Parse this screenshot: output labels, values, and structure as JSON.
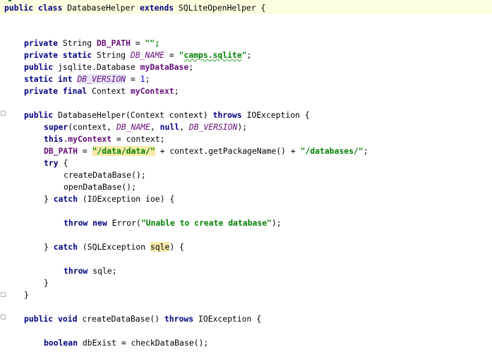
{
  "editor": {
    "lines": {
      "l1": {
        "kw_public": "public",
        "kw_class": "class",
        "name": "DatabaseHelper",
        "kw_extends": "extends",
        "parent": "SQLiteOpenHelper",
        "brace": "{"
      },
      "l2": {
        "kw_private": "private",
        "type": "String",
        "name": "DB_PATH",
        "eq": "=",
        "val": "\"\";"
      },
      "l3": {
        "kw_private": "private",
        "kw_static": "static",
        "type": "String",
        "name": "DB_NAME",
        "eq": "=",
        "val_q1": "\"",
        "val_word": "camps.sqlite",
        "val_q2": "\"",
        "semi": ";"
      },
      "l4": {
        "kw_public": "public",
        "type": "jsqlite.Database",
        "name": "myDataBase",
        "semi": ";"
      },
      "l5": {
        "kw_static": "static",
        "kw_int": "int",
        "name": "DB_VERSION",
        "eq": "=",
        "val": "1",
        "semi": ";"
      },
      "l6": {
        "kw_private": "private",
        "kw_final": "final",
        "type": "Context",
        "name": "myContext",
        "semi": ";"
      },
      "l7": {
        "kw_public": "public",
        "sig": "DatabaseHelper(Context context)",
        "kw_throws": "throws",
        "exc": "IOException {"
      },
      "l8": {
        "kw_super": "super",
        "open": "(context,",
        "arg1": "DB_NAME",
        "comma": ",",
        "kw_null": "null",
        "comma2": ",",
        "arg2": "DB_VERSION",
        "close": ");"
      },
      "l9": {
        "kw_this": "this",
        "dot": ".",
        "field": "myContext",
        "rest": "= context;"
      },
      "l10": {
        "name": "DB_PATH",
        "eq": "=",
        "str1": "\"/data/data/\"",
        "mid": "+ context.getPackageName() +",
        "str2": "\"/databases/\"",
        "semi": ";"
      },
      "l11": {
        "kw_try": "try",
        "brace": "{"
      },
      "l12": {
        "call": "createDataBase();"
      },
      "l13": {
        "call": "openDataBase();"
      },
      "l14": {
        "close": "}",
        "kw_catch": "catch",
        "rest": "(IOException ioe) {"
      },
      "l15": {
        "kw_throw": "throw",
        "kw_new": "new",
        "cls": "Error(",
        "str": "\"Unable to create database\"",
        "end": ");"
      },
      "l16": {
        "close": "}",
        "kw_catch": "catch",
        "open": "(SQLException",
        "var": "sqle",
        "end": ") {"
      },
      "l17": {
        "kw_throw": "throw",
        "rest": "sqle;"
      },
      "l18": {
        "close": "}"
      },
      "l19": {
        "close": "}"
      },
      "l20": {
        "kw_public": "public",
        "kw_void": "void",
        "sig": "createDataBase()",
        "kw_throws": "throws",
        "exc": "IOException {"
      },
      "l21": {
        "kw_boolean": "boolean",
        "rest": "dbExist = checkDataBase();"
      }
    }
  },
  "colors": {
    "keyword": "#000080",
    "string": "#008000",
    "number": "#0000ff",
    "field": "#660e7a",
    "current_line": "#fffde0"
  }
}
